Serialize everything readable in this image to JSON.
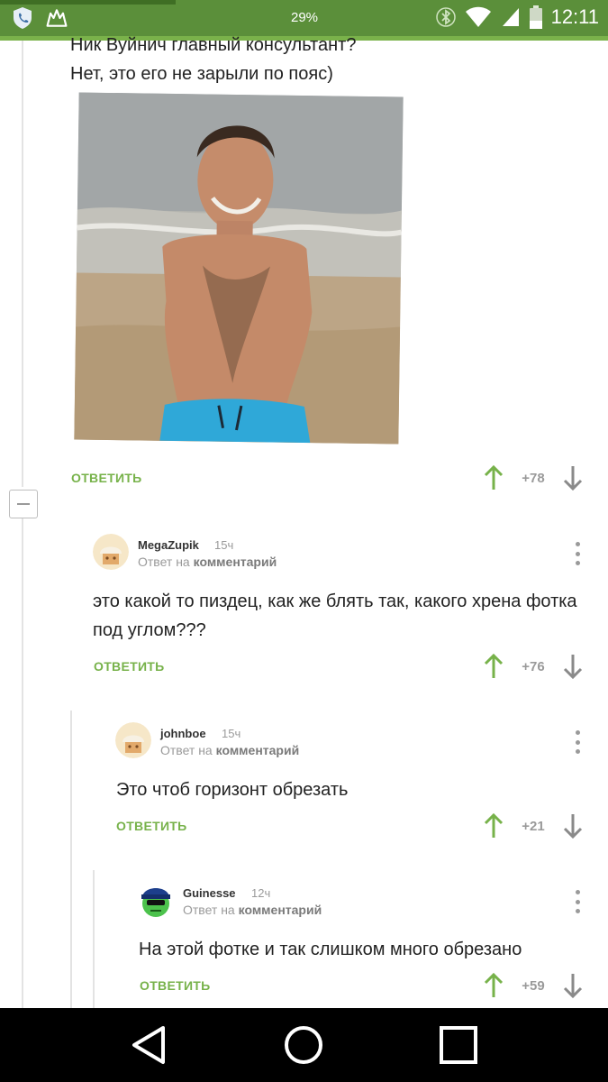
{
  "status_bar": {
    "battery_percent": "29%",
    "time": "12:11",
    "icons": [
      "shield-phone-icon",
      "pikabu-icon",
      "bluetooth-icon",
      "wifi-icon",
      "signal-icon",
      "battery-icon"
    ]
  },
  "parent_comment": {
    "line1": "Ник Вуйнич главный консультант?",
    "line2": "Нет, это его не зарыли по пояс)",
    "reply_label": "ОТВЕТИТЬ",
    "score": "+78"
  },
  "comments": [
    {
      "author": "MegaZupik",
      "time": "15ч",
      "reply_prefix": "Ответ на",
      "reply_target": "комментарий",
      "text_line1": "это какой то пиздец, как же блять так, какого хрена фотка",
      "text_line2": "под углом???",
      "reply_label": "ОТВЕТИТЬ",
      "score": "+76"
    },
    {
      "author": "johnboe",
      "time": "15ч",
      "reply_prefix": "Ответ на",
      "reply_target": "комментарий",
      "text_line1": "Это чтоб горизонт обрезать",
      "reply_label": "ОТВЕТИТЬ",
      "score": "+21"
    },
    {
      "author": "Guinesse",
      "time": "12ч",
      "reply_prefix": "Ответ на",
      "reply_target": "комментарий",
      "text_line1": "На этой фотке и так слишком много обрезано",
      "reply_label": "ОТВЕТИТЬ",
      "score": "+59"
    }
  ],
  "colors": {
    "accent_green": "#77b24a",
    "status_bar": "#5b8f3a",
    "muted": "#9a9a9a"
  }
}
